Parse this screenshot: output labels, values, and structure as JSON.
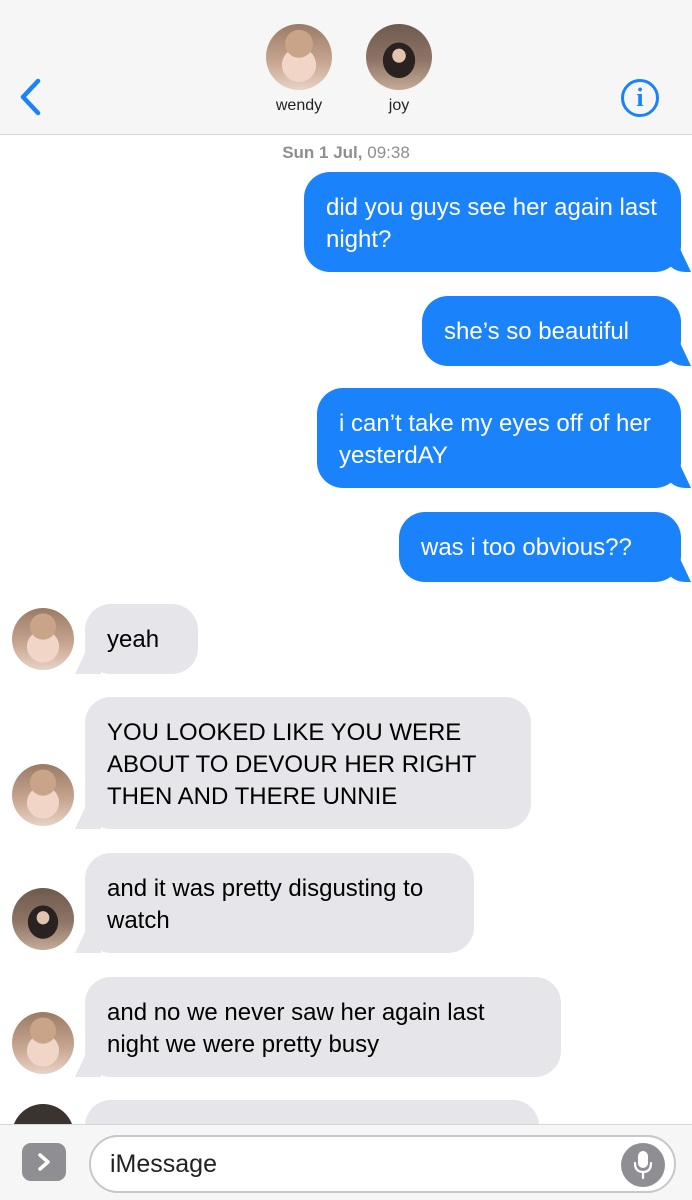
{
  "header": {
    "contacts": [
      {
        "name": "wendy",
        "avatar": "wendy-avatar"
      },
      {
        "name": "joy",
        "avatar": "joy-avatar"
      }
    ],
    "back_icon": "chevron-left-icon",
    "info_icon": "info-icon",
    "info_glyph": "i"
  },
  "conversation": {
    "timestamp_day": "Sun 1 Jul,",
    "timestamp_time": "09:38",
    "messages": [
      {
        "from": "me",
        "text": "did you guys see her again last night?"
      },
      {
        "from": "me",
        "text": "she’s so beautiful"
      },
      {
        "from": "me",
        "text": "i can’t take my eyes off of her yesterdAY"
      },
      {
        "from": "me",
        "text": "was i too obvious??"
      },
      {
        "from": "wendy",
        "text": "yeah"
      },
      {
        "from": "wendy",
        "text": "YOU LOOKED LIKE YOU WERE ABOUT TO DEVOUR HER RIGHT THEN AND THERE UNNIE"
      },
      {
        "from": "joy",
        "text": "and it was pretty disgusting to watch"
      },
      {
        "from": "wendy",
        "text": "and no we never saw her again last night we were pretty busy"
      }
    ]
  },
  "composer": {
    "placeholder": "iMessage",
    "apps_icon": "chevron-right-icon",
    "mic_icon": "microphone-icon"
  },
  "colors": {
    "sent_bubble": "#1a82fb",
    "received_bubble": "#e5e5ea",
    "accent": "#1a82fb"
  }
}
